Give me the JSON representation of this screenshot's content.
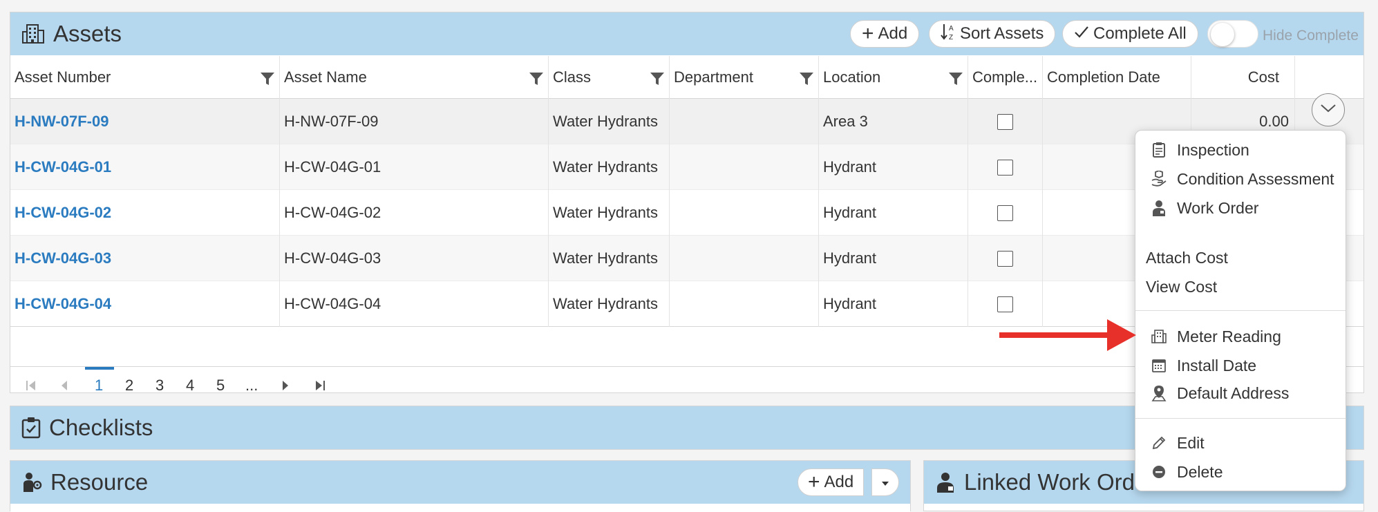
{
  "assets": {
    "title": "Assets",
    "add_label": "Add",
    "sort_label": "Sort Assets",
    "complete_all_label": "Complete All",
    "hide_complete_label": "Hide Complete",
    "columns": [
      "Asset Number",
      "Asset Name",
      "Class",
      "Department",
      "Location",
      "Comple...",
      "Completion Date",
      "Cost"
    ],
    "rows": [
      {
        "number": "H-NW-07F-09",
        "name": "H-NW-07F-09",
        "class": "Water Hydrants",
        "department": "",
        "location": "Area 3",
        "completion_date": "",
        "cost": "0.00"
      },
      {
        "number": "H-CW-04G-01",
        "name": "H-CW-04G-01",
        "class": "Water Hydrants",
        "department": "",
        "location": "Hydrant",
        "completion_date": "",
        "cost": ""
      },
      {
        "number": "H-CW-04G-02",
        "name": "H-CW-04G-02",
        "class": "Water Hydrants",
        "department": "",
        "location": "Hydrant",
        "completion_date": "",
        "cost": ""
      },
      {
        "number": "H-CW-04G-03",
        "name": "H-CW-04G-03",
        "class": "Water Hydrants",
        "department": "",
        "location": "Hydrant",
        "completion_date": "",
        "cost": ""
      },
      {
        "number": "H-CW-04G-04",
        "name": "H-CW-04G-04",
        "class": "Water Hydrants",
        "department": "",
        "location": "Hydrant",
        "completion_date": "",
        "cost": ""
      }
    ],
    "pager": {
      "pages": [
        "1",
        "2",
        "3",
        "4",
        "5",
        "..."
      ],
      "current": "1"
    }
  },
  "checklists": {
    "title": "Checklists"
  },
  "resource": {
    "title": "Resource",
    "add_label": "Add"
  },
  "linked_work_orders": {
    "title": "Linked Work Orde"
  },
  "menu": {
    "items": [
      {
        "label": "Inspection",
        "icon": "clipboard-icon"
      },
      {
        "label": "Condition Assessment",
        "icon": "hand-box-icon"
      },
      {
        "label": "Work Order",
        "icon": "worker-icon"
      },
      {
        "label": "Attach Cost",
        "icon": ""
      },
      {
        "label": "View Cost",
        "icon": ""
      },
      {
        "label": "Meter Reading",
        "icon": "building-icon"
      },
      {
        "label": "Install Date",
        "icon": "calendar-icon"
      },
      {
        "label": "Default Address",
        "icon": "map-pin-person-icon"
      },
      {
        "label": "Edit",
        "icon": "pencil-icon"
      },
      {
        "label": "Delete",
        "icon": "minus-circle-icon"
      }
    ]
  },
  "colors": {
    "header_bg": "#b6d8ef",
    "link": "#2a7bbf",
    "arrow": "#e8302a"
  }
}
